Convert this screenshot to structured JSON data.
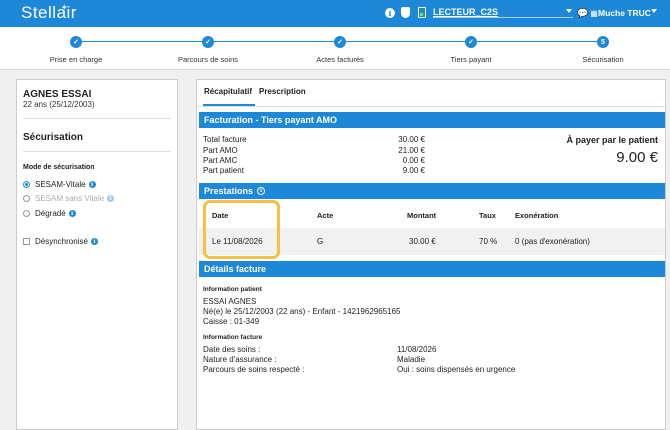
{
  "topbar": {
    "logo": "Stellair",
    "reader": "LECTEUR_C2S",
    "user": "Muche TRUC"
  },
  "steps": [
    {
      "label": "Prise en charge",
      "mark": "✓"
    },
    {
      "label": "Parcours de soins",
      "mark": "✓"
    },
    {
      "label": "Actes facturés",
      "mark": "✓"
    },
    {
      "label": "Tiers payant",
      "mark": "✓"
    },
    {
      "label": "Sécurisation",
      "mark": "5"
    }
  ],
  "patient": {
    "name": "AGNES ESSAI",
    "age_dob": "22 ans (25/12/2003)"
  },
  "securisation": {
    "title": "Sécurisation",
    "mode_label": "Mode de sécurisation",
    "options": [
      "SESAM-Vitale",
      "SESAM sans Vitale",
      "Dégradé"
    ],
    "selected": "SESAM-Vitale",
    "desync_label": "Désynchronisé"
  },
  "tabs": [
    "Récapitulatif",
    "Prescription"
  ],
  "facturation": {
    "title": "Facturation - Tiers payant AMO",
    "rows": [
      {
        "label": "Total facture",
        "value": "30.00 €"
      },
      {
        "label": "Part AMO",
        "value": "21.00 €"
      },
      {
        "label": "Part AMC",
        "value": "0.00 €"
      },
      {
        "label": "Part patient",
        "value": "9.00 €"
      }
    ],
    "pay_label": "À payer par le patient",
    "pay_amount": "9.00 €"
  },
  "prestations": {
    "title": "Prestations",
    "headers": [
      "Date",
      "Acte",
      "Montant",
      "Taux",
      "Exonération"
    ],
    "row": {
      "date": "Le 11/08/2026",
      "acte": "G",
      "montant": "30.00 €",
      "taux": "70 %",
      "exoneration": "0 (pas d'exonération)"
    }
  },
  "details": {
    "title": "Détails facture",
    "info_patient_label": "Information patient",
    "patient_lines": [
      "ESSAI AGNES",
      "Né(e) le 25/12/2003 (22 ans) - Enfant - 1421962965165",
      "Caisse : 01-349"
    ],
    "info_facture_label": "Information facture",
    "facture_rows": [
      {
        "label": "Date des soins :",
        "value": "11/08/2026"
      },
      {
        "label": "Nature d'assurance :",
        "value": "Maladie"
      },
      {
        "label": "Parcours de soins respecté :",
        "value": "Oui : soins dispensés en urgence"
      }
    ]
  },
  "colors": {
    "primary": "#1e88d8",
    "highlight": "#f5c043"
  }
}
